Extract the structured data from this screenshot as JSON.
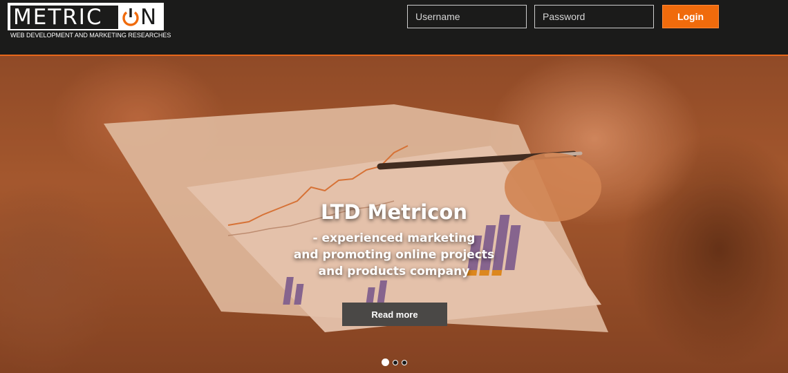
{
  "brand": {
    "name_left": "METRIC",
    "name_right": "N",
    "tagline": "WEB DEVELOPMENT AND MARKETING RESEARCHES",
    "icon": "power-icon"
  },
  "login": {
    "username_placeholder": "Username",
    "username_value": "",
    "password_placeholder": "Password",
    "password_value": "",
    "button_label": "Login"
  },
  "hero": {
    "title": "LTD Metricon",
    "subtitle_lines": [
      "- experienced marketing",
      "and promoting online projects",
      "and products company"
    ],
    "button_label": "Read more",
    "slides_count": 3,
    "active_slide": 1
  },
  "colors": {
    "accent": "#f06b0c",
    "header_bg": "#1b1b1a",
    "button_dark": "#4a4846"
  }
}
